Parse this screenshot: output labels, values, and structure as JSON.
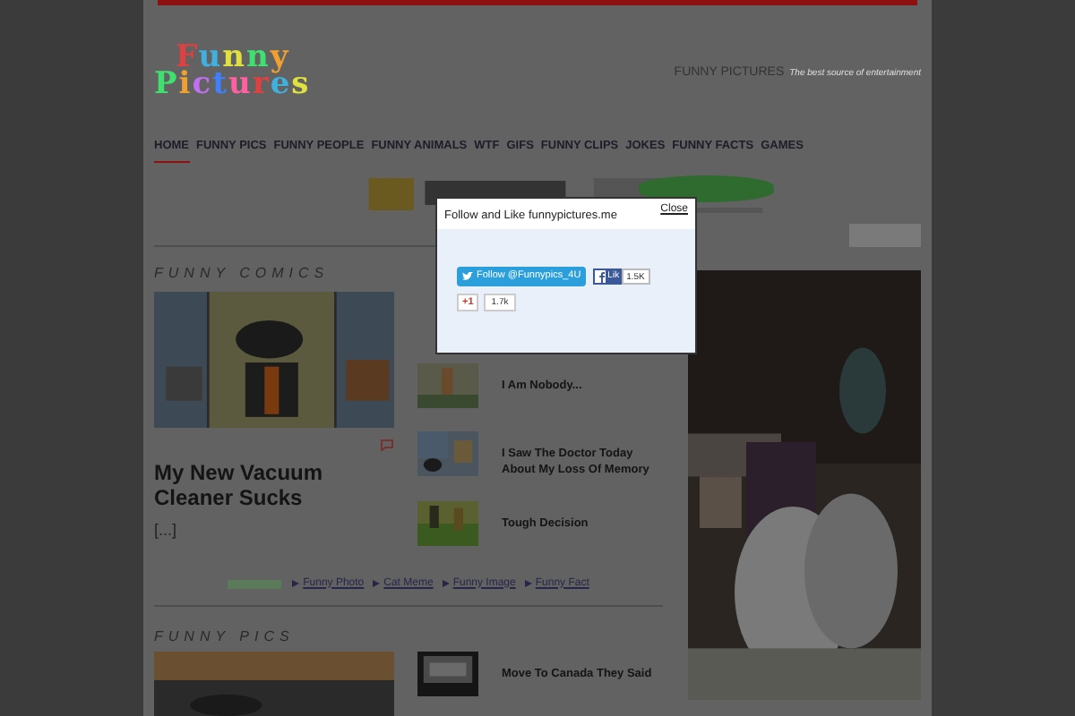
{
  "site": {
    "logo_lines": [
      "Funny",
      "Pictures"
    ],
    "name": "FUNNY PICTURES",
    "tagline": "The best source of entertainment"
  },
  "nav": [
    {
      "label": "HOME",
      "selected": true
    },
    {
      "label": "FUNNY PICS",
      "selected": false
    },
    {
      "label": "FUNNY PEOPLE",
      "selected": false
    },
    {
      "label": "FUNNY ANIMALS",
      "selected": false
    },
    {
      "label": "WTF",
      "selected": false
    },
    {
      "label": "GIFS",
      "selected": false
    },
    {
      "label": "FUNNY CLIPS",
      "selected": false
    },
    {
      "label": "JOKES",
      "selected": false
    },
    {
      "label": "FUNNY FACTS",
      "selected": false
    },
    {
      "label": "GAMES",
      "selected": false
    }
  ],
  "comics": {
    "title": "FUNNY COMICS",
    "featured": {
      "title": "My New Vacuum Cleaner Sucks",
      "excerpt": "[...]"
    },
    "list": [
      {
        "title": "I Am Nobody..."
      },
      {
        "title": "I Saw The Doctor Today About My Loss Of Memory"
      },
      {
        "title": "Tough Decision"
      }
    ]
  },
  "links": [
    "Funny Photo",
    "Cat Meme",
    "Funny Image",
    "Funny Fact"
  ],
  "pics": {
    "title": "FUNNY PICS",
    "list": [
      {
        "title": "Move To Canada They Said"
      }
    ]
  },
  "modal": {
    "title": "Follow and Like funnypictures.me",
    "close": "Close",
    "twitter": "Follow @Funnypics_4U",
    "facebook": "Lik",
    "facebook_count": "1.5K",
    "gplus": "+1",
    "gplus_count": "1.7k"
  }
}
